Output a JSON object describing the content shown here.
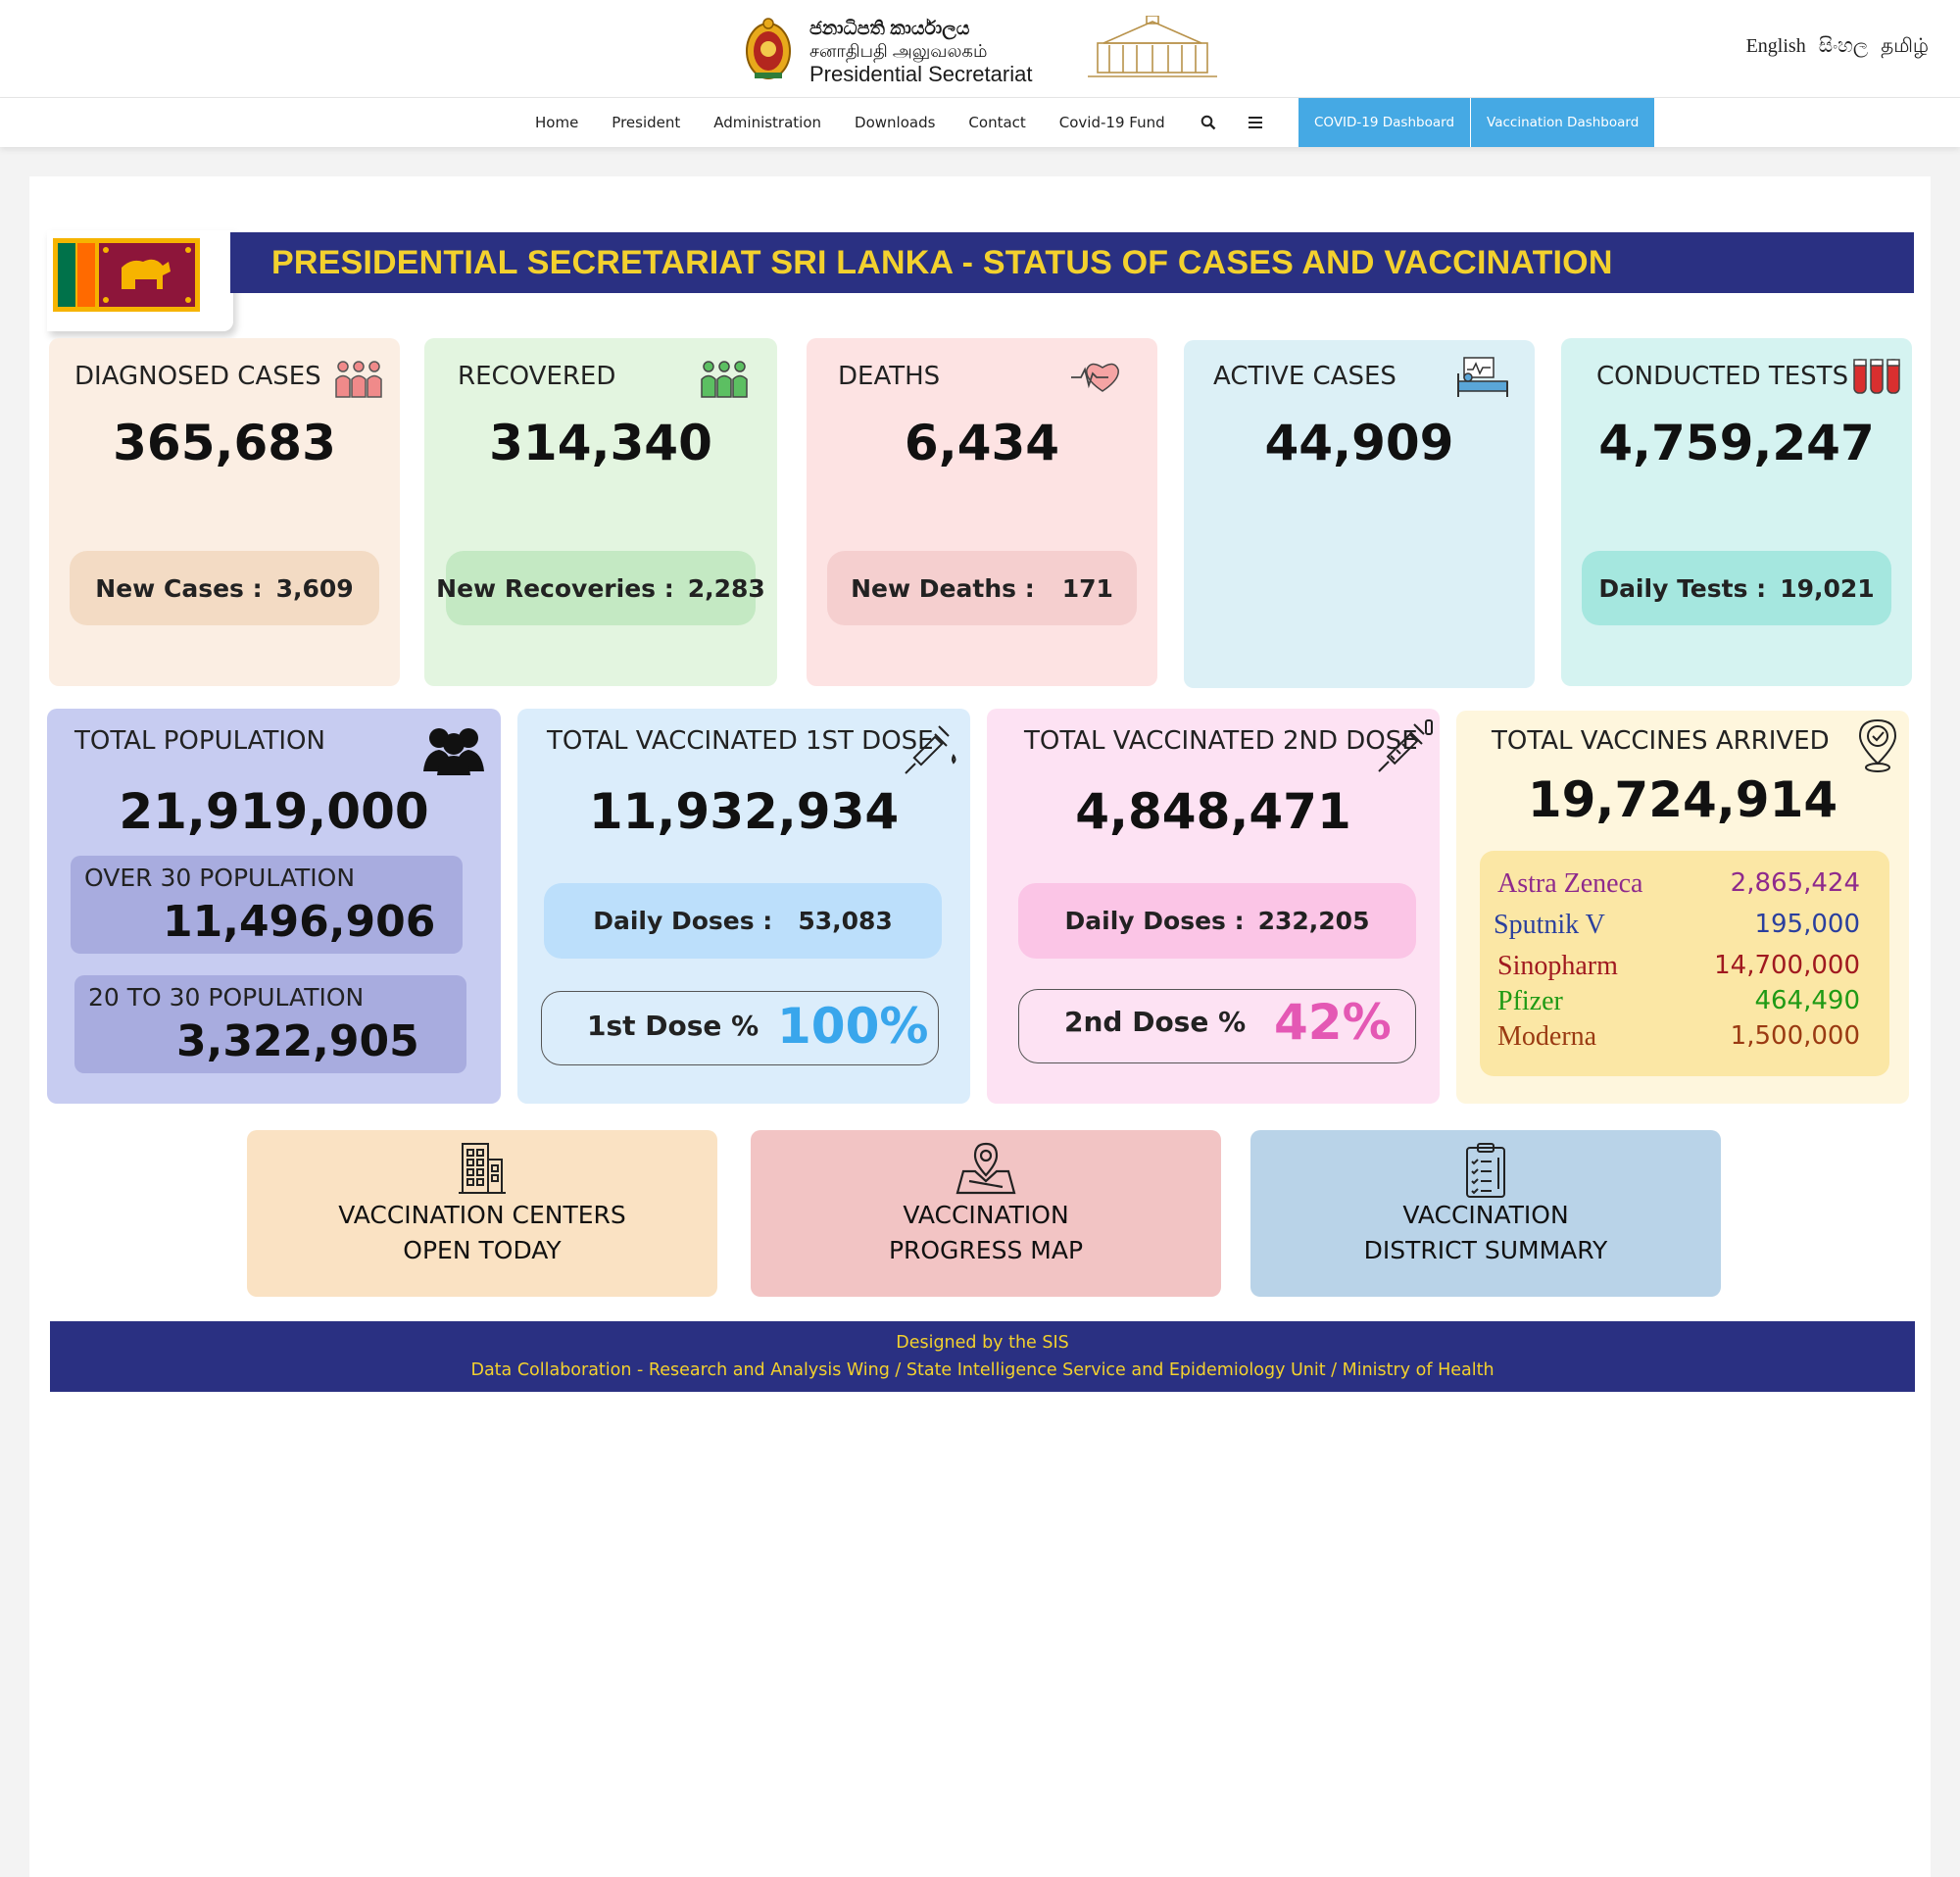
{
  "header": {
    "brand_line1": "ජනාධිපති කාර්යාලය",
    "brand_line2": "சனாதிபதி அலுவலகம்",
    "brand_line3": "Presidential Secretariat",
    "languages": [
      "English",
      "සිංහල",
      "தமிழ்"
    ]
  },
  "nav": {
    "items": [
      "Home",
      "President",
      "Administration",
      "Downloads",
      "Contact",
      "Covid-19 Fund"
    ],
    "buttons": [
      "COVID-19 Dashboard",
      "Vaccination Dashboard"
    ],
    "accent_color": "#45a9e4"
  },
  "banner": {
    "title": "PRESIDENTIAL SECRETARIAT SRI LANKA - STATUS OF CASES AND VACCINATION",
    "bar_color": "#2a3082",
    "text_color": "#f3d12e"
  },
  "stats": {
    "diagnosed": {
      "title": "DIAGNOSED CASES",
      "value": "365,683",
      "pill_label": "New Cases :",
      "pill_value": "3,609"
    },
    "recovered": {
      "title": "RECOVERED",
      "value": "314,340",
      "pill_label": "New Recoveries :",
      "pill_value": "2,283"
    },
    "deaths": {
      "title": "DEATHS",
      "value": "6,434",
      "pill_label": "New Deaths :",
      "pill_value": "171"
    },
    "active": {
      "title": "ACTIVE CASES",
      "value": "44,909"
    },
    "tests": {
      "title": "CONDUCTED TESTS",
      "value": "4,759,247",
      "pill_label": "Daily Tests :",
      "pill_value": "19,021"
    }
  },
  "population": {
    "title": "TOTAL POPULATION",
    "value": "21,919,000",
    "over30_title": "OVER 30 POPULATION",
    "over30_value": "11,496,906",
    "age20to30_title": "20 TO 30 POPULATION",
    "age20to30_value": "3,322,905"
  },
  "dose1": {
    "title": "TOTAL VACCINATED 1ST DOSE",
    "value": "11,932,934",
    "pill_label": "Daily Doses :",
    "pill_value": "53,083",
    "pct_label": "1st Dose %",
    "pct_value": "100%",
    "pct_color": "#39a6ec"
  },
  "dose2": {
    "title": "TOTAL VACCINATED 2ND DOSE",
    "value": "4,848,471",
    "pill_label": "Daily Doses :",
    "pill_value": "232,205",
    "pct_label": "2nd Dose %",
    "pct_value": "42%",
    "pct_color": "#e458b4"
  },
  "vaccines": {
    "title": "TOTAL VACCINES ARRIVED",
    "value": "19,724,914",
    "items": [
      {
        "name": "Astra Zeneca",
        "qty": "2,865,424",
        "color": "#8e2a8c"
      },
      {
        "name": "Sputnik V",
        "qty": "195,000",
        "color": "#2a3f9e"
      },
      {
        "name": "Sinopharm",
        "qty": "14,700,000",
        "color": "#a0191f"
      },
      {
        "name": "Pfizer",
        "qty": "464,490",
        "color": "#1f9a15"
      },
      {
        "name": "Moderna",
        "qty": "1,500,000",
        "color": "#9a3a12"
      }
    ]
  },
  "links": [
    {
      "line1": "VACCINATION CENTERS",
      "line2": "OPEN TODAY"
    },
    {
      "line1": "VACCINATION",
      "line2": "PROGRESS MAP"
    },
    {
      "line1": "VACCINATION",
      "line2": "DISTRICT SUMMARY"
    }
  ],
  "footer": {
    "line1": "Designed by the SIS",
    "line2": "Data Collaboration - Research and Analysis Wing / State Intelligence Service and Epidemiology Unit / Ministry of Health"
  }
}
